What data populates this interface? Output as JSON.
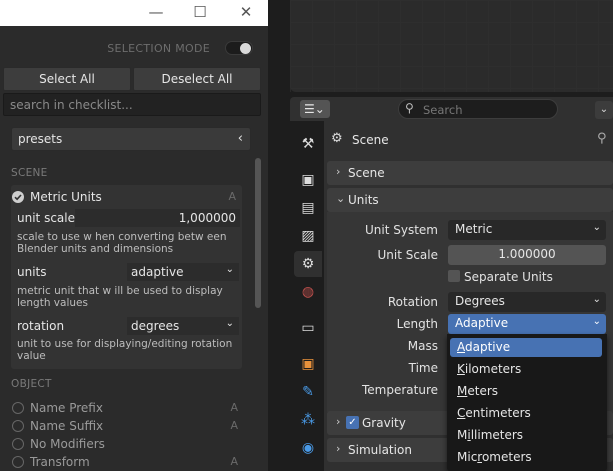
{
  "checklist_window": {
    "controls": {
      "minimize": "—",
      "maximize": "☐",
      "close": "✕"
    },
    "selection_mode_label": "SELECTION MODE",
    "select_all": "Select All",
    "deselect_all": "Deselect All",
    "search_placeholder": "search in checklist...",
    "presets_label": "presets",
    "scene_header": "SCENE",
    "metric_units": {
      "label": "Metric Units",
      "badge": "A",
      "unit_scale_label": "unit scale",
      "unit_scale_value": "1,000000",
      "unit_scale_desc": "scale to use w hen converting betw een Blender units and dimensions",
      "units_label": "units",
      "units_value": "adaptive",
      "units_desc": "metric unit that w ill be used to display length values",
      "rotation_label": "rotation",
      "rotation_value": "degrees",
      "rotation_desc": "unit to use for displaying/editing rotation value"
    },
    "object_header": "OBJECT",
    "object_items": [
      {
        "label": "Name Prefix",
        "badge": "A"
      },
      {
        "label": "Name Suffix",
        "badge": "A"
      },
      {
        "label": "No Modifiers",
        "badge": ""
      },
      {
        "label": "Transform",
        "badge": "A"
      }
    ]
  },
  "properties": {
    "search_placeholder": "Search",
    "context_title": "Scene",
    "panels": {
      "scene": "Scene",
      "units": "Units",
      "gravity": "Gravity",
      "simulation": "Simulation"
    },
    "units": {
      "unit_system_label": "Unit System",
      "unit_system_value": "Metric",
      "unit_scale_label": "Unit Scale",
      "unit_scale_value": "1.000000",
      "separate_units_label": "Separate Units",
      "rotation_label": "Rotation",
      "rotation_value": "Degrees",
      "length_label": "Length",
      "length_value": "Adaptive",
      "mass_label": "Mass",
      "time_label": "Time",
      "temperature_label": "Temperature"
    },
    "length_menu": {
      "items": [
        {
          "pre": "",
          "u": "A",
          "post": "daptive"
        },
        {
          "pre": "",
          "u": "K",
          "post": "ilometers"
        },
        {
          "pre": "",
          "u": "M",
          "post": "eters"
        },
        {
          "pre": "",
          "u": "C",
          "post": "entimeters"
        },
        {
          "pre": "M",
          "u": "i",
          "post": "llimeters"
        },
        {
          "pre": "Mic",
          "u": "r",
          "post": "ometers"
        }
      ]
    }
  }
}
